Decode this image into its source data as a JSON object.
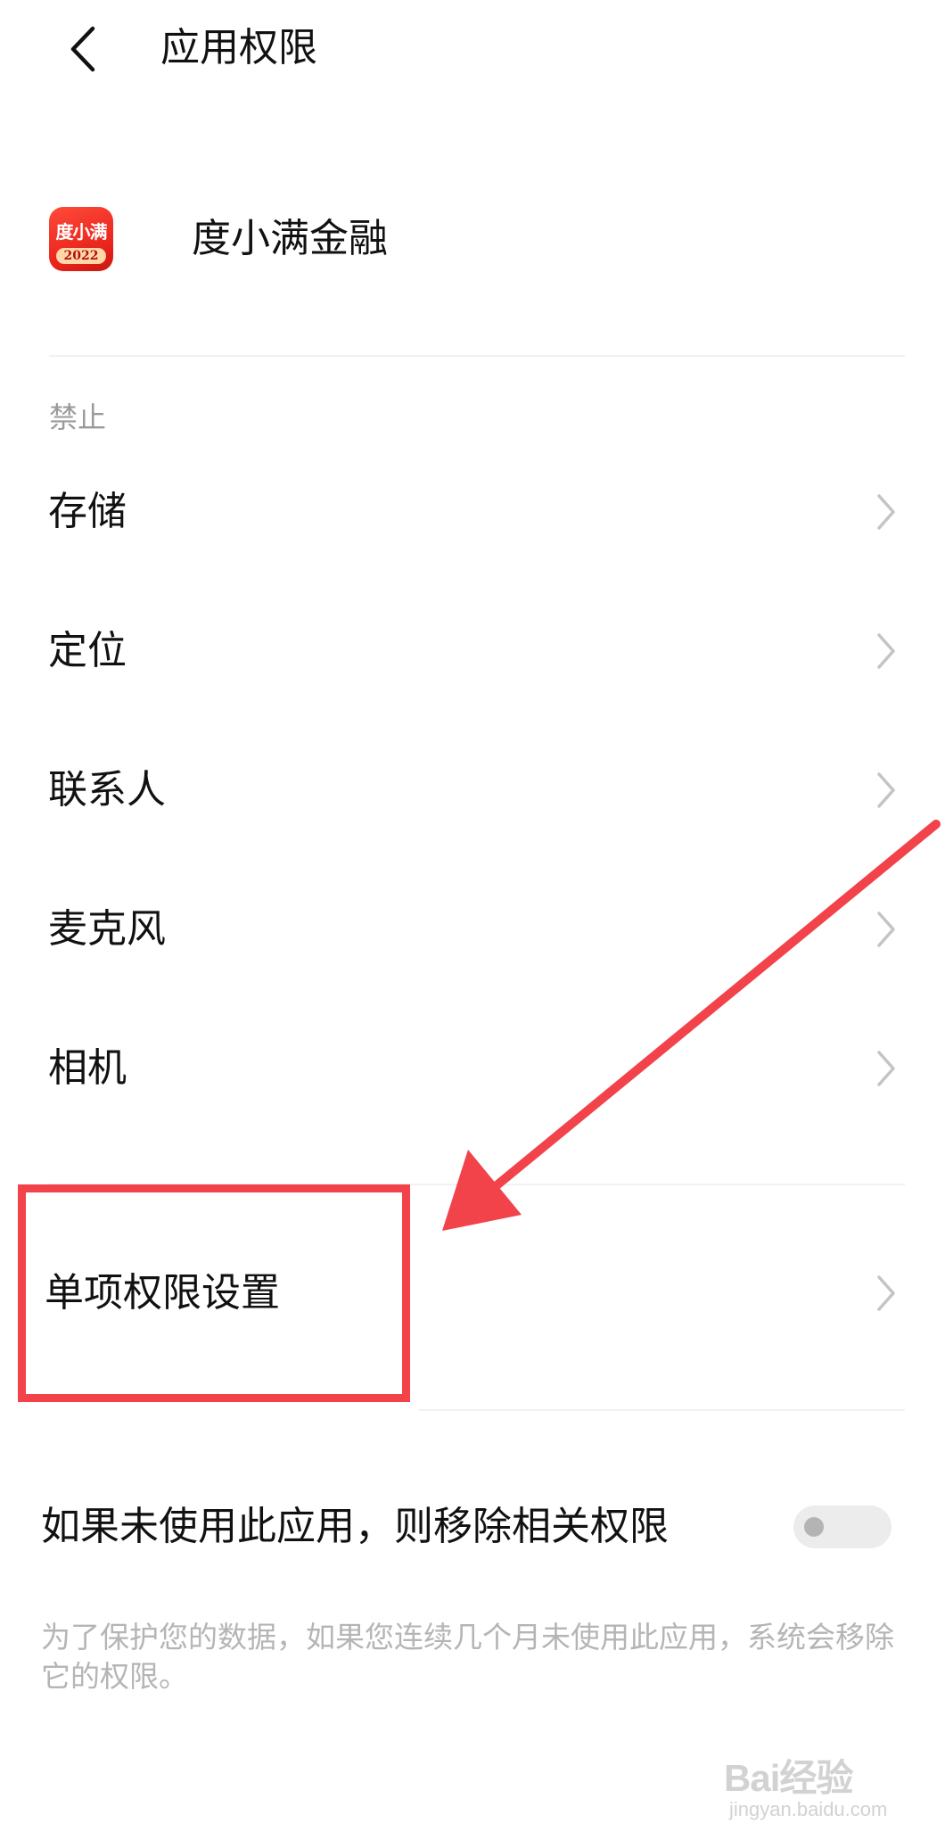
{
  "header": {
    "title": "应用权限"
  },
  "app": {
    "icon_text": "度小满",
    "icon_year": "2022",
    "name": "度小满金融"
  },
  "denied_section": {
    "label": "禁止",
    "items": [
      {
        "label": "存储"
      },
      {
        "label": "定位"
      },
      {
        "label": "联系人"
      },
      {
        "label": "麦克风"
      },
      {
        "label": "相机"
      }
    ]
  },
  "single_permission": {
    "label": "单项权限设置"
  },
  "auto_revoke": {
    "label": "如果未使用此应用，则移除相关权限",
    "enabled": false,
    "description": "为了保护您的数据，如果您连续几个月未使用此应用，系统会移除它的权限。"
  },
  "watermark": {
    "main": "Bai经验",
    "sub": "jingyan.baidu.com"
  },
  "colors": {
    "annotation_red": "#f2424a",
    "app_icon_red": "#e8231b",
    "section_label": "#9a9a9a",
    "description_text": "#b5b5b5"
  }
}
